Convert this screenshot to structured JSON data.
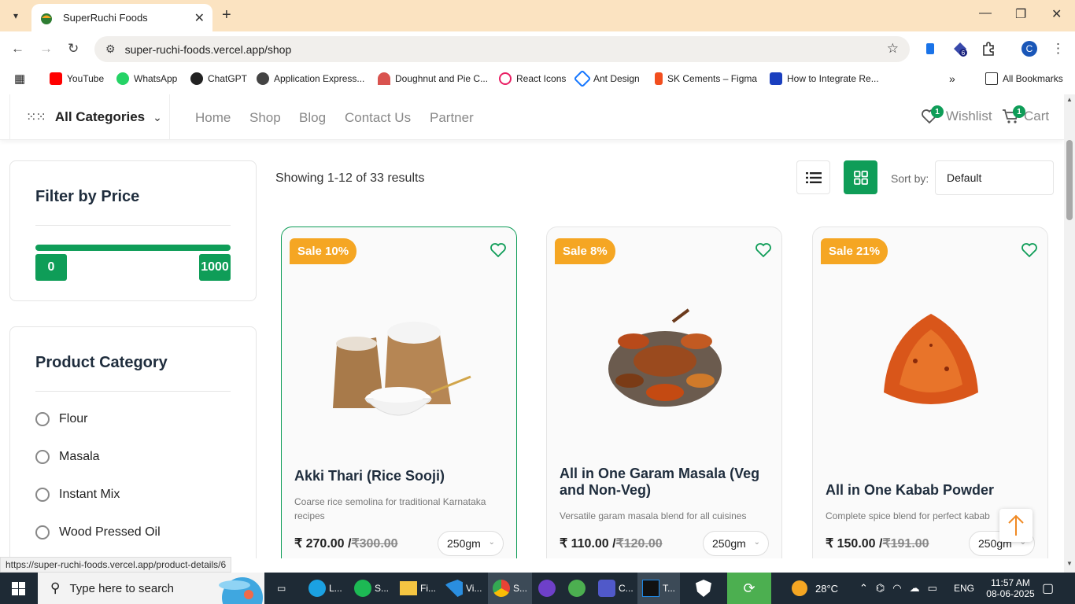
{
  "browser": {
    "tab_title": "SuperRuchi Foods",
    "url": "super-ruchi-foods.vercel.app/shop",
    "profile_initial": "C",
    "ext_badge": "6",
    "bookmarks": [
      "YouTube",
      "WhatsApp",
      "ChatGPT",
      "Application Express...",
      "Doughnut and Pie C...",
      "React Icons",
      "Ant Design",
      "SK Cements – Figma",
      "How to Integrate Re..."
    ],
    "all_bookmarks": "All Bookmarks"
  },
  "nav": {
    "all_categories": "All Categories",
    "menu": [
      "Home",
      "Shop",
      "Blog",
      "Contact Us",
      "Partner"
    ],
    "wishlist": "Wishlist",
    "wishlist_count": "1",
    "cart": "Cart",
    "cart_count": "1"
  },
  "filter": {
    "title": "Filter by Price",
    "min": "0",
    "max": "1000"
  },
  "category": {
    "title": "Product Category",
    "items": [
      "Flour",
      "Masala",
      "Instant Mix",
      "Wood Pressed Oil"
    ]
  },
  "toolbar": {
    "showing": "Showing 1-12 of 33 results",
    "sort_label": "Sort by:",
    "sort_value": "Default"
  },
  "products": [
    {
      "sale": "Sale 10%",
      "name": "Akki Thari (Rice Sooji)",
      "desc": "Coarse rice semolina for traditional Karnataka recipes",
      "price": "₹ 270.00",
      "old": "₹300.00",
      "weight": "250gm"
    },
    {
      "sale": "Sale 8%",
      "name": "All in One Garam Masala (Veg and Non-Veg)",
      "desc": "Versatile garam masala blend for all cuisines",
      "price": "₹ 110.00",
      "old": "₹120.00",
      "weight": "250gm"
    },
    {
      "sale": "Sale 21%",
      "name": "All in One Kabab Powder",
      "desc": "Complete spice blend for perfect kabab",
      "price": "₹ 150.00",
      "old": "₹191.00",
      "weight": "250gm"
    }
  ],
  "status_url": "https://super-ruchi-foods.vercel.app/product-details/6",
  "taskbar": {
    "search_placeholder": "Type here to search",
    "apps": [
      "L...",
      "S...",
      "Fi...",
      "Vi...",
      "S...",
      "",
      "",
      "C...",
      "T..."
    ],
    "weather": "28°C",
    "lang": "ENG",
    "time": "11:57 AM",
    "date": "08-06-2025"
  },
  "colors": {
    "brand_green": "#0f9d58",
    "sale_orange": "#f5a623",
    "tab_bar": "#fbe3c1"
  }
}
